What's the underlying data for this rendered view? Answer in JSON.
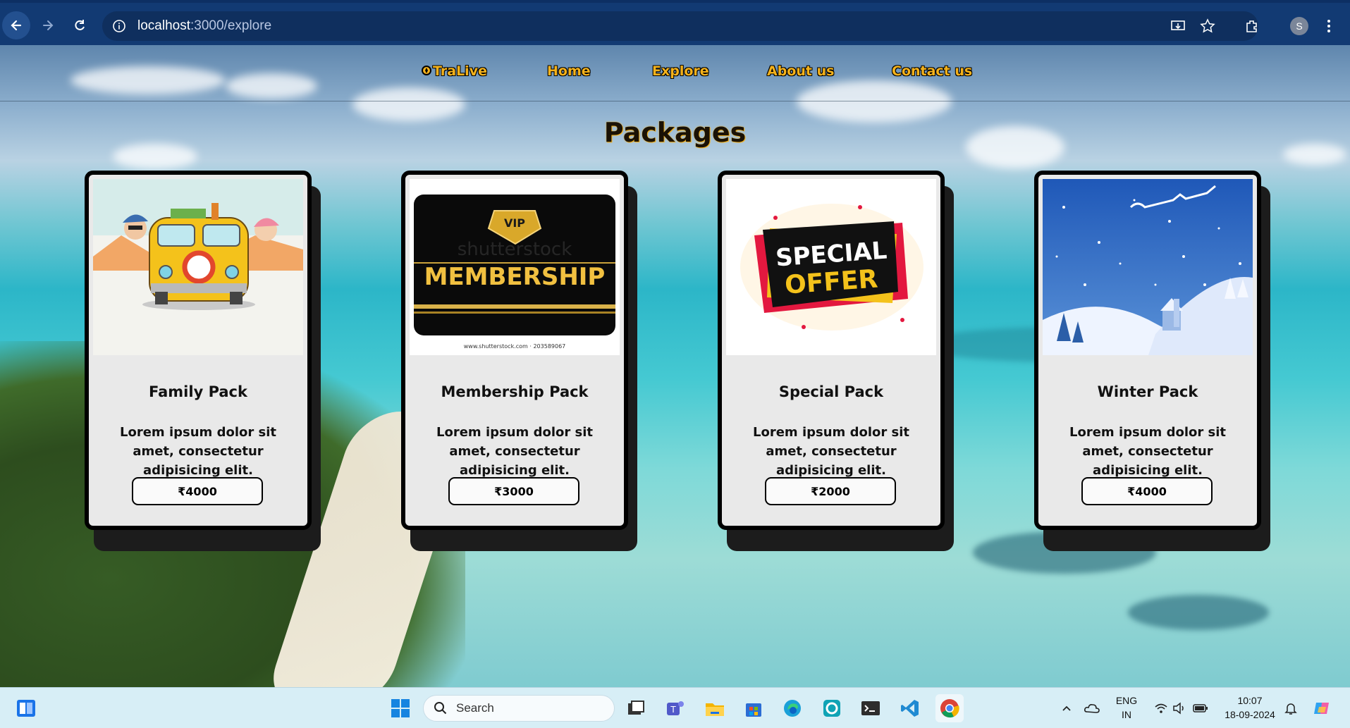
{
  "browser": {
    "url_host": "localhost",
    "url_path": ":3000/explore",
    "profile_initial": "S"
  },
  "nav": {
    "brand": "TraLive",
    "links": [
      "Home",
      "Explore",
      "About us",
      "Contact us"
    ]
  },
  "main": {
    "title": "Packages",
    "cards": [
      {
        "title": "Family Pack",
        "description": "Lorem ipsum dolor sit amet, consectetur adipisicing elit.",
        "price": "4000",
        "image": "family-van-illustration"
      },
      {
        "title": "Membership Pack",
        "description": "Lorem ipsum dolor sit amet, consectetur adipisicing elit.",
        "price": "3000",
        "image": "vip-membership-card"
      },
      {
        "title": "Special Pack",
        "description": "Lorem ipsum dolor sit amet, consectetur adipisicing elit.",
        "price": "2000",
        "image": "special-offer-banner"
      },
      {
        "title": "Winter Pack",
        "description": "Lorem ipsum dolor sit amet, consectetur adipisicing elit.",
        "price": "4000",
        "image": "winter-snow-scene"
      }
    ],
    "currency_symbol": "₹",
    "membership_image_text": {
      "badge": "VIP",
      "word": "MEMBERSHIP",
      "watermark": "shutterstock",
      "footer": "www.shutterstock.com · 203589067"
    },
    "special_image_text": {
      "line1": "SPECIAL",
      "line2": "OFFER"
    }
  },
  "taskbar": {
    "search_placeholder": "Search",
    "language": "ENG",
    "region": "IN",
    "time": "10:07",
    "date": "18-09-2024"
  },
  "colors": {
    "accent_nav": "#f5b21b",
    "browser_bar": "#123a73",
    "card_bg": "#e9e9e9"
  }
}
